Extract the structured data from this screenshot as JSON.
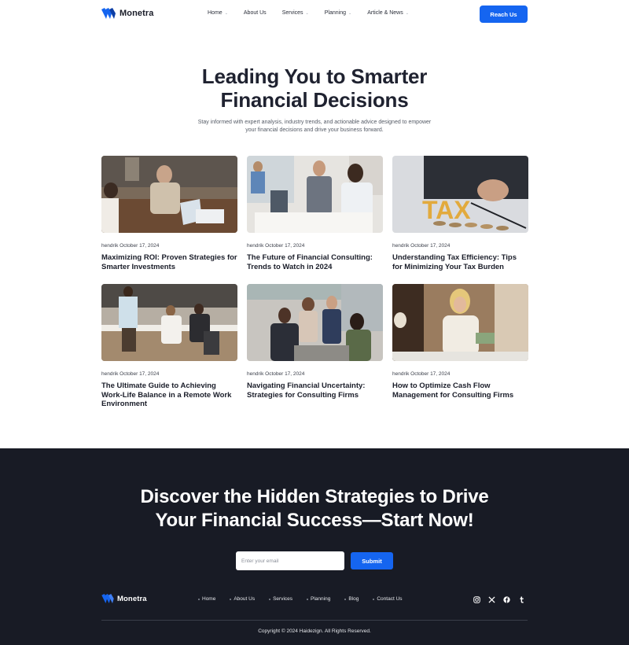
{
  "brand": {
    "name": "Monetra",
    "accent": "#1565f0",
    "dark_bg": "#181b25"
  },
  "nav": {
    "items": [
      {
        "label": "Home",
        "has_dropdown": true
      },
      {
        "label": "About Us",
        "has_dropdown": false
      },
      {
        "label": "Services",
        "has_dropdown": true
      },
      {
        "label": "Planning",
        "has_dropdown": true
      },
      {
        "label": "Article & News",
        "has_dropdown": true
      }
    ],
    "cta_label": "Reach Us"
  },
  "hero": {
    "title_line1": "Leading You to Smarter",
    "title_line2": "Financial Decisions",
    "subtitle_line1": "Stay informed with expert analysis, industry trends, and actionable advice designed to empower",
    "subtitle_line2": "your financial decisions and drive your business forward."
  },
  "articles": [
    {
      "author": "hendrik",
      "date": "October 17, 2024",
      "title": "Maximizing ROI: Proven Strategies for Smarter Investments",
      "image": "business-meeting-photo"
    },
    {
      "author": "hendrik",
      "date": "October 17, 2024",
      "title": "The Future of Financial Consulting: Trends to Watch in 2024",
      "image": "consulting-team-photo"
    },
    {
      "author": "hendrik",
      "date": "October 17, 2024",
      "title": "Understanding Tax Efficiency: Tips for Minimizing Your Tax Burden",
      "image": "tax-coins-photo"
    },
    {
      "author": "hendrik",
      "date": "October 17, 2024",
      "title": "The Ultimate Guide to Achieving Work-Life Balance in a Remote Work Environment",
      "image": "office-workers-photo"
    },
    {
      "author": "hendrik",
      "date": "October 17, 2024",
      "title": "Navigating Financial Uncertainty: Strategies for Consulting Firms",
      "image": "team-planning-photo"
    },
    {
      "author": "hendrik",
      "date": "October 17, 2024",
      "title": "How to Optimize Cash Flow Management for Consulting Firms",
      "image": "woman-counting-cash-photo"
    }
  ],
  "footer": {
    "title_line1": "Discover the Hidden Strategies to Drive",
    "title_line2": "Your Financial Success—Start Now!",
    "email_placeholder": "Enter your email",
    "submit_label": "Submit",
    "brand_name": "Monetra",
    "links": [
      "Home",
      "About Us",
      "Services",
      "Planning",
      "Blog",
      "Contact Us"
    ],
    "social_icons": [
      "instagram-icon",
      "x-icon",
      "facebook-icon",
      "tumblr-icon"
    ],
    "copyright": "Copyright © 2024 Haidezign. All Rights Reserved."
  }
}
